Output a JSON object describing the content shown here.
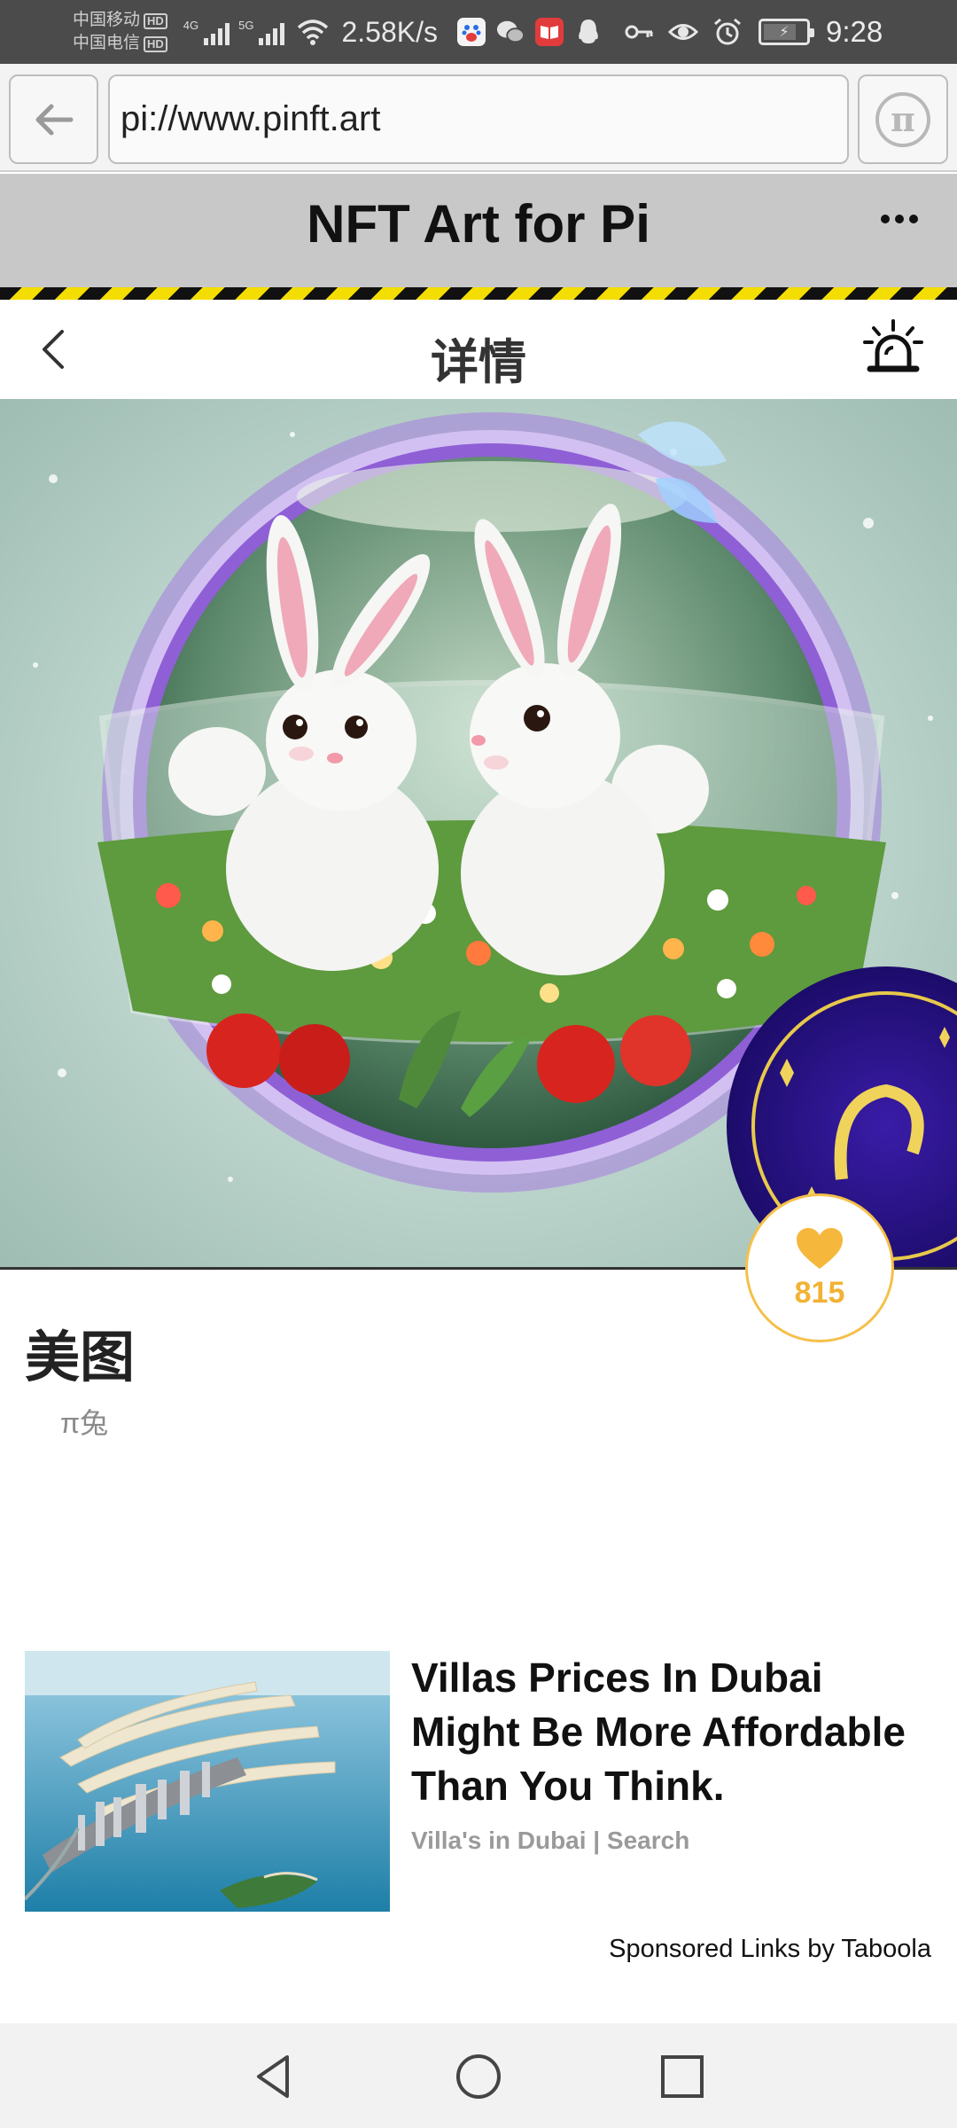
{
  "status_bar": {
    "carrier_1": "中国移动",
    "carrier_2": "中国电信",
    "hd_badge": "HD",
    "network_1": "4G",
    "network_2": "5G",
    "speed": "2.58K/s",
    "time": "9:28",
    "app_icons": [
      "baidu-icon",
      "wechat-icon",
      "reader-icon",
      "qq-icon"
    ],
    "system_icons": [
      "key-icon",
      "eye-icon",
      "alarm-clock-icon",
      "battery-icon"
    ]
  },
  "browser": {
    "url": "pi://www.pinft.art",
    "back_icon": "arrow-left-icon",
    "pi_icon": "pi-logo-icon"
  },
  "app_header": {
    "title": "NFT Art for Pi",
    "menu_icon": "more-dots-icon"
  },
  "detail": {
    "title": "详情",
    "back_icon": "chevron-left-icon",
    "action_icon": "alarm-light-icon"
  },
  "artwork": {
    "subject": "two-rabbits-in-glass-bowl",
    "likes": "815"
  },
  "info": {
    "name": "美图",
    "author": "π兔"
  },
  "ad": {
    "headline": "Villas Prices In Dubai Might Be More Affordable Than You Think.",
    "source": "Villa's in Dubai | Search",
    "sponsored": "Sponsored Links by Taboola"
  },
  "nav": {
    "back_icon": "nav-back-icon",
    "home_icon": "nav-home-icon",
    "recents_icon": "nav-recents-icon"
  },
  "colors": {
    "status_bar": "#4b4b4b",
    "app_header": "#c8c8c8",
    "stripe_yellow": "#f4dd00",
    "like_accent": "#f2b233"
  }
}
